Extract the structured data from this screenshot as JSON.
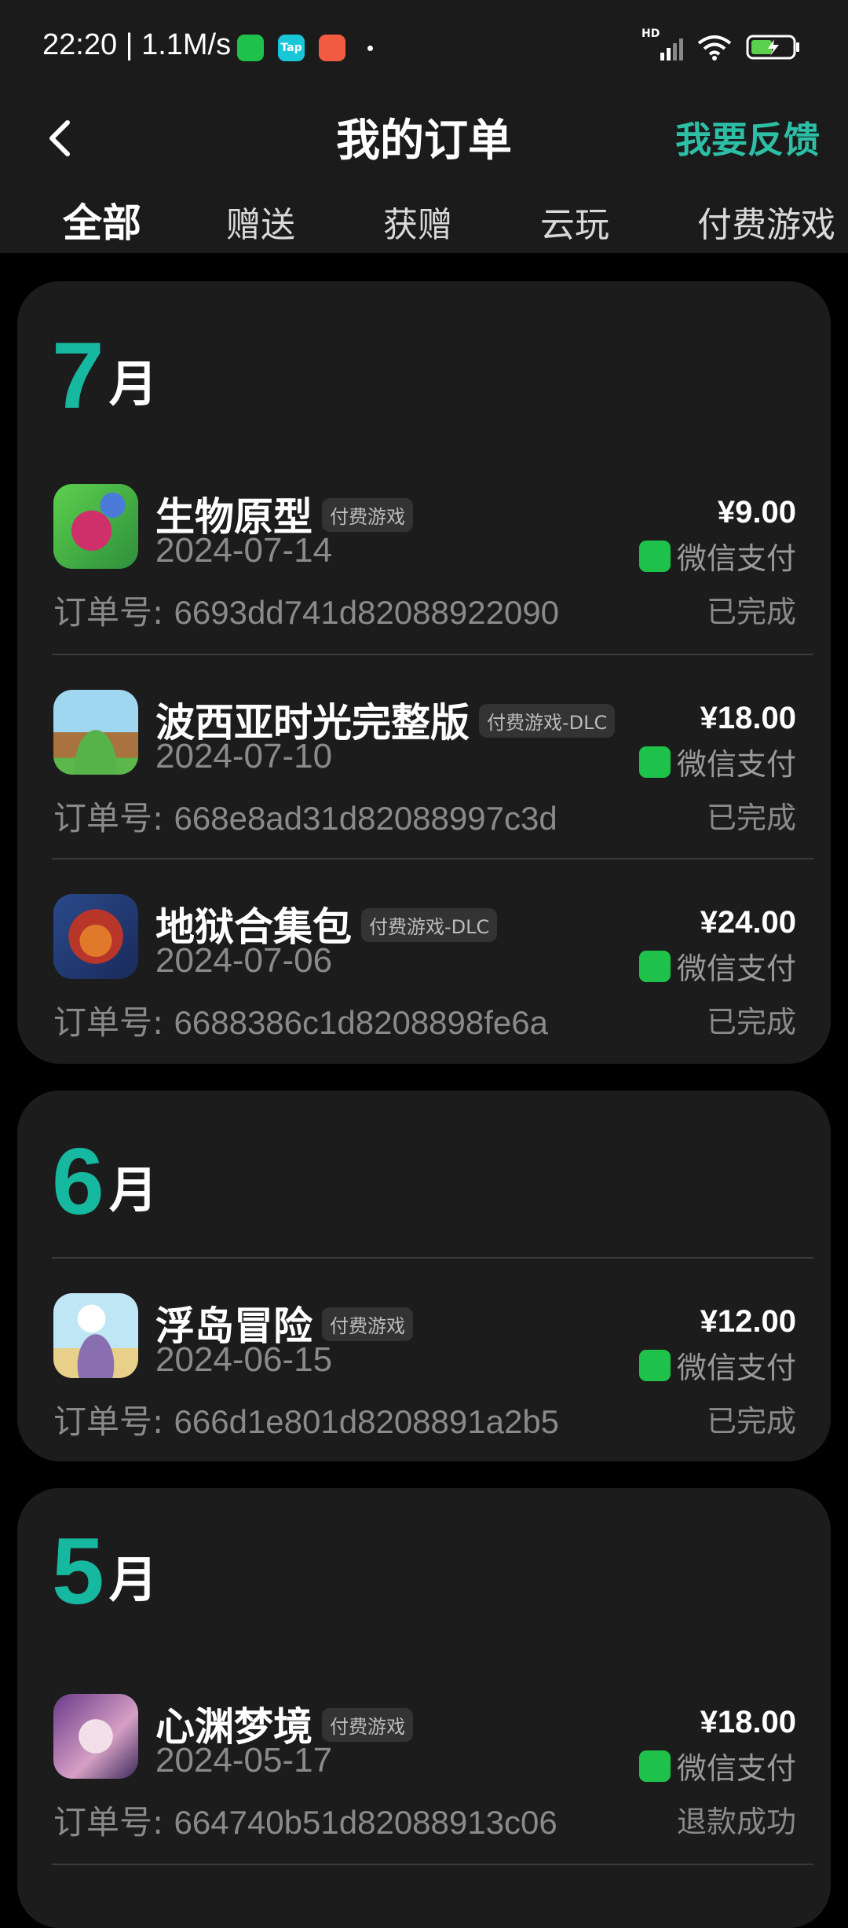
{
  "status_bar": {
    "time": "22:20 | 1.1M/s",
    "net_label": "HD"
  },
  "header": {
    "title": "我的订单",
    "feedback": "我要反馈"
  },
  "tabs": [
    "全部",
    "赠送",
    "获赠",
    "云玩",
    "付费游戏"
  ],
  "groups": [
    {
      "month_num": "7",
      "month_unit": "月",
      "orders": [
        {
          "name": "生物原型",
          "tag": "付费游戏",
          "date": "2024-07-14",
          "price": "¥9.00",
          "pay": "微信支付",
          "order_label": "订单号:",
          "order_no": "6693dd741d82088922090",
          "status": "已完成"
        },
        {
          "name": "波西亚时光完整版",
          "tag": "付费游戏-DLC",
          "date": "2024-07-10",
          "price": "¥18.00",
          "pay": "微信支付",
          "order_label": "订单号:",
          "order_no": "668e8ad31d82088997c3d",
          "status": "已完成"
        },
        {
          "name": "地狱合集包",
          "tag": "付费游戏-DLC",
          "date": "2024-07-06",
          "price": "¥24.00",
          "pay": "微信支付",
          "order_label": "订单号:",
          "order_no": "6688386c1d8208898fe6a",
          "status": "已完成"
        }
      ]
    },
    {
      "month_num": "6",
      "month_unit": "月",
      "orders": [
        {
          "name": "浮岛冒险",
          "tag": "付费游戏",
          "date": "2024-06-15",
          "price": "¥12.00",
          "pay": "微信支付",
          "order_label": "订单号:",
          "order_no": "666d1e801d8208891a2b5",
          "status": "已完成"
        }
      ]
    },
    {
      "month_num": "5",
      "month_unit": "月",
      "orders": [
        {
          "name": "心渊梦境",
          "tag": "付费游戏",
          "date": "2024-05-17",
          "price": "¥18.00",
          "pay": "微信支付",
          "order_label": "订单号:",
          "order_no": "664740b51d82088913c06",
          "status": "退款成功"
        }
      ]
    }
  ],
  "colors": {
    "accent": "#17b8a0",
    "wechat": "#1ec24a",
    "card": "#1c1c1c"
  }
}
